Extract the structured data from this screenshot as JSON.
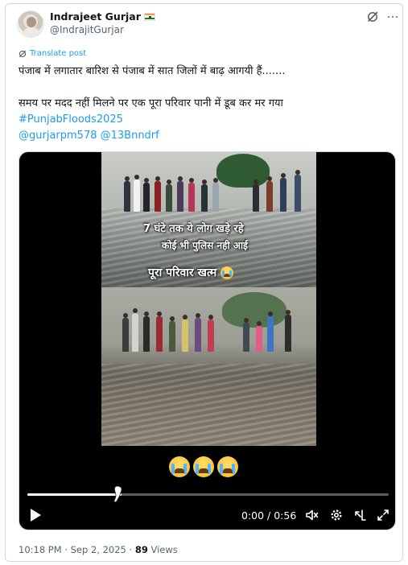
{
  "author": {
    "display_name": "Indrajeet Gurjar",
    "handle": "@IndrajitGurjar",
    "flag_icon": "india-flag-icon"
  },
  "translate": {
    "label": "Translate post"
  },
  "tweet": {
    "line1": "पंजाब में लगातार बारिश से पंजाब में सात जिलों में बाढ़ आगयी हैं.......",
    "line2": "समय पर मदद नहीं मिलने पर एक पूरा परिवार पानी में डूब कर मर गया",
    "hashtag": "#PunjabFloods2025",
    "mentions": "@gurjarpm578 @13Bnndrf"
  },
  "video": {
    "caption_line1": "7 घंटे तक ये लोग खड़े रहे",
    "caption_line2": "कोई भी पुलिस नही आई",
    "caption_line3": "पूरा परिवार खत्म",
    "elapsed": "0:00",
    "duration": "0:56",
    "time_display": "0:00 / 0:56",
    "progress_fraction": 0.26
  },
  "meta": {
    "time": "10:18 PM",
    "separator": "·",
    "date": "Sep 2, 2025",
    "views_count": "89",
    "views_label": "Views"
  },
  "colors": {
    "link": "#1d9bf0",
    "text": "#0f1419",
    "muted": "#536471",
    "border": "#cfd9de"
  }
}
